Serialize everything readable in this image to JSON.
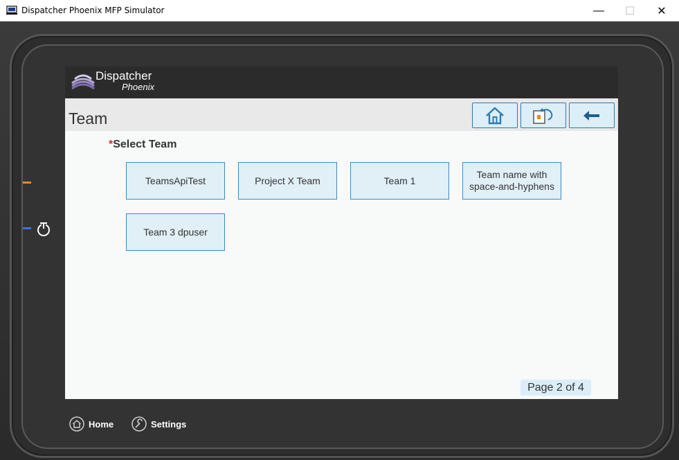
{
  "window": {
    "title": "Dispatcher Phoenix MFP Simulator",
    "controls": {
      "minimize": "—",
      "maximize": "☐",
      "close": "✕"
    }
  },
  "brand": {
    "name": "Dispatcher",
    "subtitle": "Phoenix"
  },
  "header": {
    "title": "Team",
    "buttons": [
      {
        "name": "home",
        "icon": "home-icon"
      },
      {
        "name": "back-to-app",
        "icon": "app-return-icon"
      },
      {
        "name": "back",
        "icon": "arrow-left-icon"
      }
    ]
  },
  "field": {
    "required_mark": "*",
    "label": "Select Team"
  },
  "teams": [
    {
      "label": "TeamsApiTest"
    },
    {
      "label": "Project X Team"
    },
    {
      "label": "Team 1"
    },
    {
      "label": "Team name with space-and-hyphens"
    },
    {
      "label": "Team 3 dpuser"
    }
  ],
  "pager": {
    "text": "Page 2 of 4"
  },
  "device_buttons": [
    {
      "label": "Home",
      "icon": "home-circle-icon"
    },
    {
      "label": "Settings",
      "icon": "wrench-circle-icon"
    }
  ],
  "colors": {
    "accent": "#2b7bb0",
    "button_fill": "#e1eff6",
    "required": "#d32f2f",
    "brand_bar": "#2b2b2b"
  }
}
